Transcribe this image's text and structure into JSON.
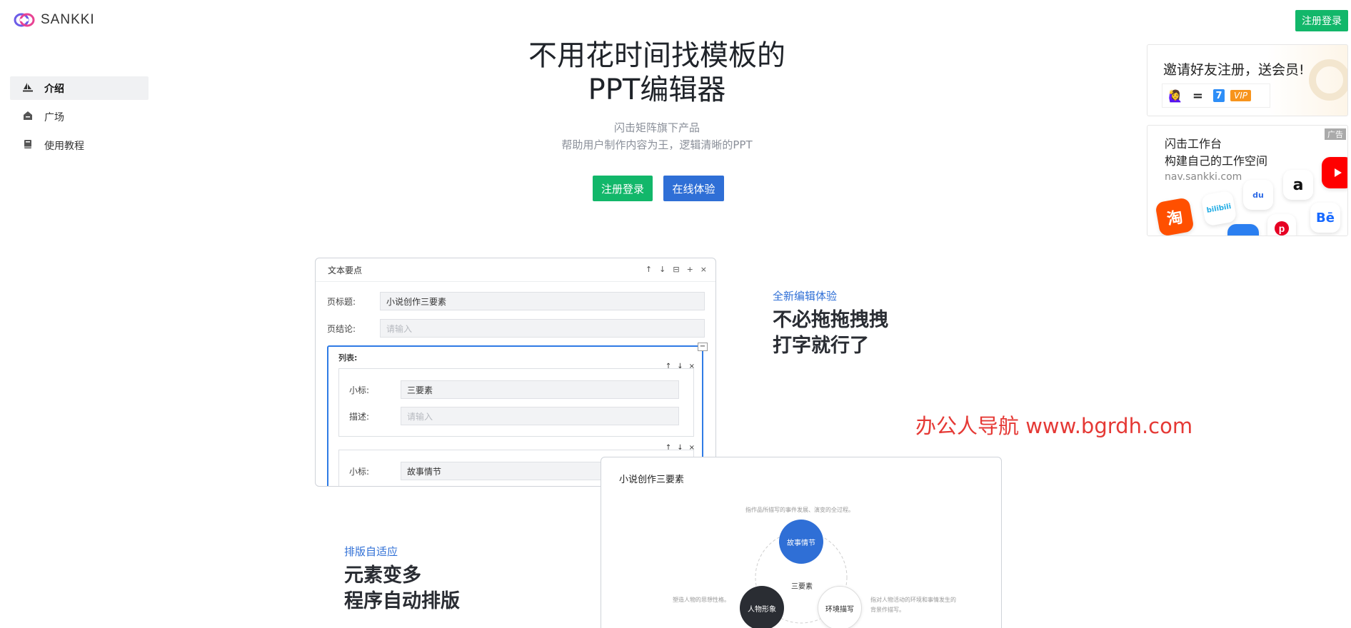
{
  "header": {
    "logo_text": "SANKKI",
    "top_register": "注册登录"
  },
  "sidebar": {
    "items": [
      {
        "label": "介绍",
        "icon": "sailboat-icon",
        "active": true
      },
      {
        "label": "广场",
        "icon": "home-icon",
        "active": false
      },
      {
        "label": "使用教程",
        "icon": "book-icon",
        "active": false
      }
    ]
  },
  "hero": {
    "title_line1": "不用花时间找模板的",
    "title_line2": "PPT编辑器",
    "subtitle_line1": "闪击矩阵旗下产品",
    "subtitle_line2": "帮助用户制作内容为王，逻辑清晰的PPT",
    "register_button": "注册登录",
    "try_button": "在线体验"
  },
  "ads": {
    "invite": {
      "title": "邀请好友注册，送会员!",
      "equals": "=",
      "days": "7",
      "vip": "VIP"
    },
    "workspace": {
      "badge": "广告",
      "title_line1": "闪击工作台",
      "title_line2": "构建自己的工作空间",
      "url": "nav.sankki.com",
      "apps": [
        "淘",
        "bilibili",
        "du",
        "a",
        "Bē"
      ]
    }
  },
  "editor": {
    "header_title": "文本要点",
    "tools": [
      "↑",
      "↓",
      "⊟",
      "+",
      "×"
    ],
    "page_title_label": "页标题:",
    "page_title_value": "小说创作三要素",
    "page_conclusion_label": "页结论:",
    "page_conclusion_placeholder": "请输入",
    "list_label": "列表:",
    "collapse": "−",
    "item1_sub_label": "小标:",
    "item1_sub_value": "三要素",
    "item1_desc_label": "描述:",
    "item1_desc_placeholder": "请输入",
    "item2_sub_label": "小标:",
    "item2_sub_value": "故事情节",
    "mini_tools": [
      "↑",
      "↓",
      "×"
    ]
  },
  "features": {
    "f1_tag": "全新编辑体验",
    "f1_line1": "不必拖拖拽拽",
    "f1_line2": "打字就行了",
    "f2_tag": "排版自适应",
    "f2_line1": "元素变多",
    "f2_line2": "程序自动排版"
  },
  "watermark": "办公人导航 www.bgrdh.com",
  "slide": {
    "title": "小说创作三要素",
    "top_note": "指作品所描写的事件发展、演变的全过程。",
    "center_label": "三要素",
    "node_top": "故事情节",
    "node_left": "人物形象",
    "node_right": "环境描写",
    "left_note": "塑造人物的思想性格。",
    "right_note_line1": "指对人物活动的环境和事情发生的",
    "right_note_line2": "背景作描写。"
  },
  "colors": {
    "green": "#12b76a",
    "blue": "#2f6fd6",
    "watermark_red": "#e53935"
  }
}
